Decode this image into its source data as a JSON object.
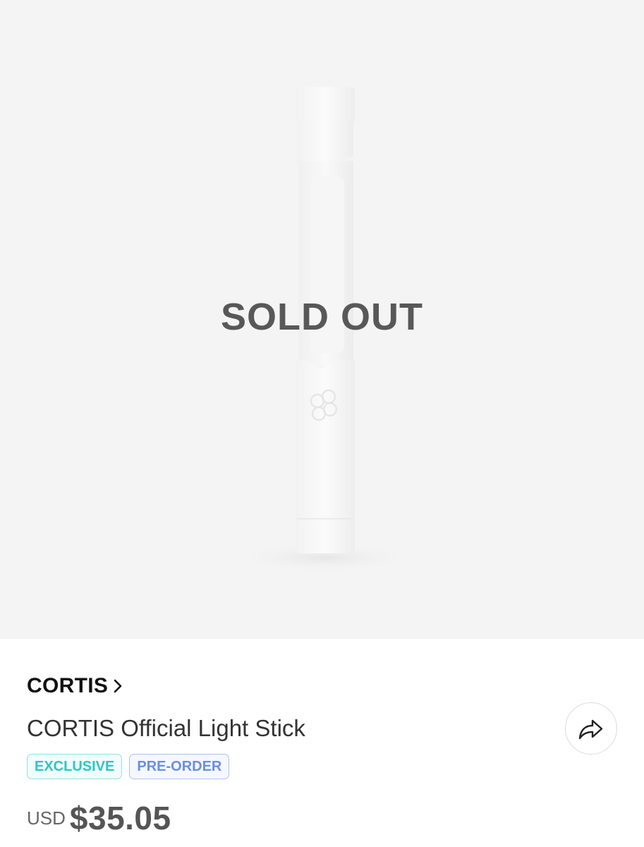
{
  "product_image": {
    "overlay_text": "SOLD OUT"
  },
  "brand": {
    "name": "CORTIS",
    "icon": "chevron-right-icon"
  },
  "product": {
    "title": "CORTIS Official Light Stick",
    "tags": [
      {
        "label": "EXCLUSIVE",
        "color": "#2cc6c6"
      },
      {
        "label": "PRE-ORDER",
        "color": "#6b8ee0"
      }
    ]
  },
  "share": {
    "icon": "share-arrow-icon"
  },
  "price": {
    "currency": "USD",
    "amount": "$35.05"
  },
  "colors": {
    "image_background": "#f4f4f4",
    "sold_out_text": "#585858",
    "price_text": "#555555"
  }
}
